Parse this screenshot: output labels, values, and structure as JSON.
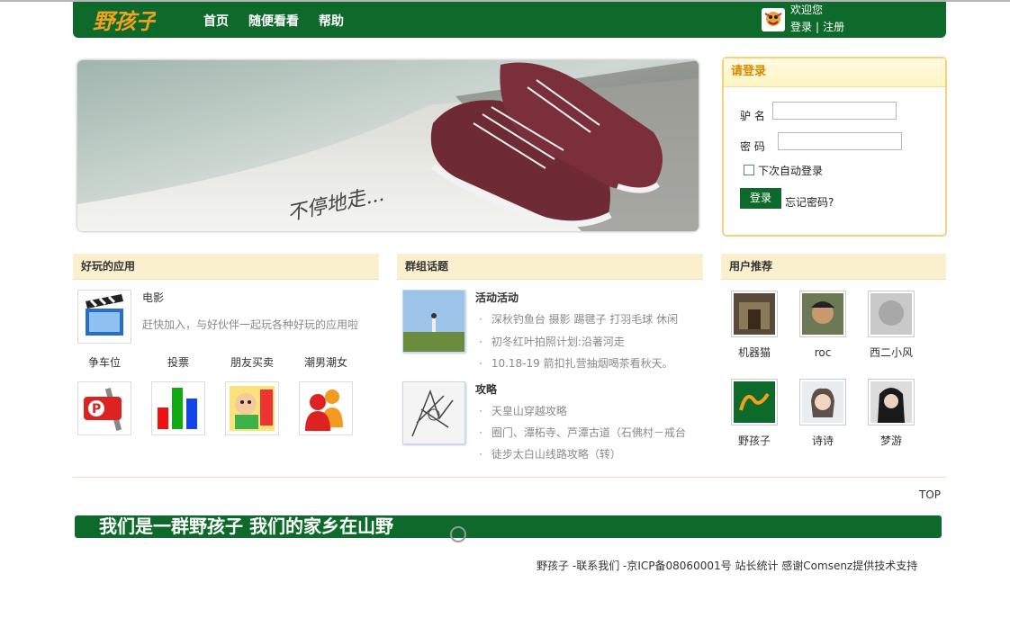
{
  "header": {
    "logo_text": "野孩子",
    "nav": [
      "首页",
      "随便看看",
      "帮助"
    ],
    "welcome": "欢迎您",
    "login_link": "登录",
    "register_link": "注册",
    "sep": "|"
  },
  "banner": {
    "caption": "不停地走..."
  },
  "login": {
    "title": "请登录",
    "username_label": "驴 名",
    "password_label": "密 码",
    "remember_label": "下次自动登录",
    "submit_label": "登录",
    "forgot_label": "忘记密码?"
  },
  "apps": {
    "title": "好玩的应用",
    "featured": {
      "name": "电影",
      "desc": "赶快加入，与好伙伴一起玩各种好玩的应用啦"
    },
    "items": [
      "争车位",
      "投票",
      "朋友买卖",
      "潮男潮女"
    ]
  },
  "groups": {
    "title": "群组话题",
    "sections": [
      {
        "name": "活动活动",
        "topics": [
          "深秋钓鱼台 摄影 踢毽子 打羽毛球 休闲",
          "初冬红叶拍照计划:沿著河走",
          "10.18-19 箭扣扎营抽烟喝茶看秋天。"
        ]
      },
      {
        "name": "攻略",
        "topics": [
          "天皇山穿越攻略",
          "圈门、潭柘寺、芦潭古道（石佛村－戒台",
          "徒步太白山线路攻略（转）"
        ]
      }
    ],
    "bullet": "·"
  },
  "users": {
    "title": "用户推荐",
    "list": [
      "机器猫",
      "roc",
      "西二小风",
      "野孩子",
      "诗诗",
      "梦游"
    ]
  },
  "footer": {
    "top": "TOP",
    "slogan": "我们是一群野孩子 我们的家乡在山野",
    "links": [
      "野孩子",
      "联系我们",
      "京ICP备08060001号",
      "站长统计",
      "感谢Comsenz提供技术支持"
    ],
    "dash": "-"
  },
  "colors": {
    "brand_green": "#0d6a2b",
    "accent_orange": "#d68a00",
    "section_bg": "#fbf0cd"
  }
}
